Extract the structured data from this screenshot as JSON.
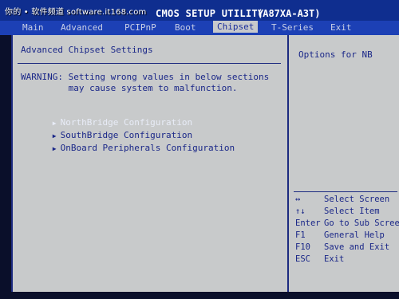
{
  "watermark": "你的 • 软件频道 software.it168.com",
  "title": {
    "utility": "CMOS SETUP UTILITY",
    "model": "(A87XA-A3T)"
  },
  "menu": {
    "items": [
      {
        "label": "Main",
        "active": false
      },
      {
        "label": "Advanced",
        "active": false
      },
      {
        "label": "PCIPnP",
        "active": false
      },
      {
        "label": "Boot",
        "active": false
      },
      {
        "label": "Chipset",
        "active": true
      },
      {
        "label": "T-Series",
        "active": false
      },
      {
        "label": "Exit",
        "active": false
      }
    ]
  },
  "page": {
    "section_title": "Advanced Chipset Settings",
    "warning_line1": "WARNING: Setting wrong values in below sections",
    "warning_line2": "         may cause system to malfunction.",
    "options": [
      {
        "label": "NorthBridge Configuration",
        "selected": true
      },
      {
        "label": "SouthBridge Configuration",
        "selected": false
      },
      {
        "label": "OnBoard Peripherals Configuration",
        "selected": false
      }
    ],
    "arrow_glyph": "▶"
  },
  "help": {
    "title": "Options for NB",
    "keys": [
      {
        "key": "↔",
        "action": "Select Screen"
      },
      {
        "key": "↑↓",
        "action": "Select Item"
      },
      {
        "key": "Enter",
        "action": "Go to Sub Screen"
      },
      {
        "key": "F1",
        "action": "General Help"
      },
      {
        "key": "F10",
        "action": "Save and Exit"
      },
      {
        "key": "ESC",
        "action": "Exit"
      }
    ]
  }
}
